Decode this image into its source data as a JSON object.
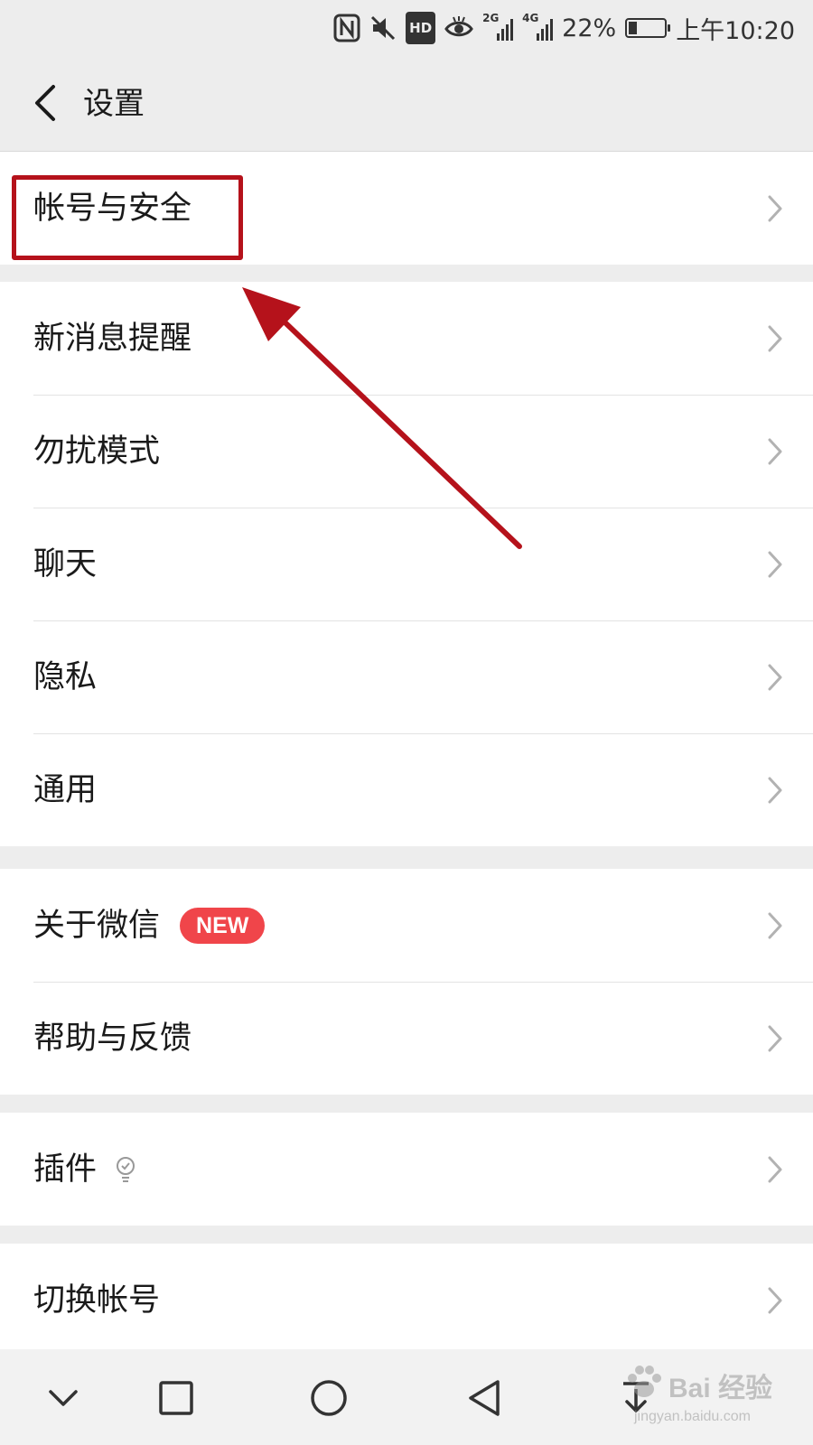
{
  "status_bar": {
    "battery": "22%",
    "time": "上午10:20",
    "hd_label": "HD",
    "net1_label": "2G",
    "net2_label": "4G",
    "icons": [
      "nfc-icon",
      "mute-icon",
      "hd-icon",
      "eye-comfort-icon",
      "signal-2g-icon",
      "signal-4g-icon",
      "battery-icon"
    ]
  },
  "header": {
    "title": "设置",
    "back_icon": "chevron-left-icon"
  },
  "sections": [
    {
      "items": [
        {
          "label": "帐号与安全"
        }
      ]
    },
    {
      "items": [
        {
          "label": "新消息提醒"
        },
        {
          "label": "勿扰模式"
        },
        {
          "label": "聊天"
        },
        {
          "label": "隐私"
        },
        {
          "label": "通用"
        }
      ]
    },
    {
      "items": [
        {
          "label": "关于微信",
          "badge": "NEW"
        },
        {
          "label": "帮助与反馈"
        }
      ]
    },
    {
      "items": [
        {
          "label": "插件",
          "icon": "lightbulb-icon"
        }
      ]
    },
    {
      "items": [
        {
          "label": "切换帐号"
        }
      ]
    }
  ],
  "bottom_nav": {
    "icons": [
      "chevron-down-icon",
      "square-icon",
      "circle-icon",
      "triangle-back-icon",
      "download-icon"
    ]
  },
  "watermark": {
    "text": "Bai 经验",
    "url": "jingyan.baidu.com"
  },
  "colors": {
    "background": "#ededed",
    "annotation": "#b5121b",
    "badge": "#f0454a"
  }
}
